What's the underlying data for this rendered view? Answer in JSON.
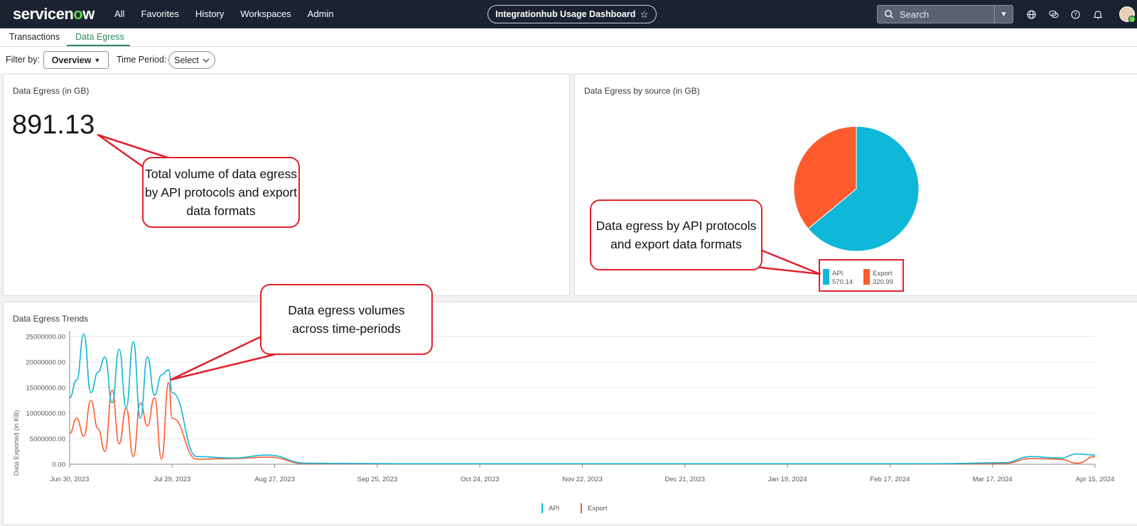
{
  "topbar": {
    "logo_text": "servicenow",
    "nav": [
      "All",
      "Favorites",
      "History",
      "Workspaces",
      "Admin"
    ],
    "title": "Integrationhub Usage Dashboard",
    "search_placeholder": "Search",
    "icons": [
      "globe-icon",
      "chat-icon",
      "help-icon",
      "bell-icon"
    ]
  },
  "tabs": [
    "Transactions",
    "Data Egress"
  ],
  "active_tab": "Data Egress",
  "filters": {
    "filter_by_label": "Filter by:",
    "filter_by_value": "Overview",
    "time_period_label": "Time Period:",
    "time_period_value": "Select"
  },
  "egress_card": {
    "title": "Data Egress (in GB)",
    "value": "891.13"
  },
  "source_card": {
    "title": "Data Egress by source (in GB)",
    "legend": [
      {
        "name": "API",
        "value": "570.14",
        "color": "#0fb7d8"
      },
      {
        "name": "Export",
        "value": "320.99",
        "color": "#ff5b2e"
      }
    ]
  },
  "trend_card": {
    "title": "Data Egress Trends",
    "ylabel": "Data Exported (in KB)",
    "legend": [
      "API",
      "Export"
    ]
  },
  "callouts": {
    "total": "Total volume of data egress by API protocols and export data formats",
    "pie": "Data egress by API protocols and export data formats",
    "trend": "Data egress volumes across time-periods"
  },
  "chart_data": [
    {
      "type": "pie",
      "title": "Data Egress by source (in GB)",
      "categories": [
        "API",
        "Export"
      ],
      "values": [
        570.14,
        320.99
      ],
      "colors": [
        "#0fb7d8",
        "#ff5b2e"
      ]
    },
    {
      "type": "line",
      "title": "Data Egress Trends",
      "ylabel": "Data Exported (in KB)",
      "ylim": [
        0,
        25000000
      ],
      "yticks": [
        "0.00",
        "5000000.00",
        "10000000.00",
        "15000000.00",
        "20000000.00",
        "25000000.00"
      ],
      "xticks": [
        "Jun 30, 2023",
        "Jul 29, 2023",
        "Aug 27, 2023",
        "Sep 25, 2023",
        "Oct 24, 2023",
        "Nov 22, 2023",
        "Dec 21, 2023",
        "Jan 19, 2024",
        "Feb 17, 2024",
        "Mar 17, 2024",
        "Apr 15, 2024"
      ],
      "grid": true,
      "legend_position": "bottom",
      "series": [
        {
          "name": "API",
          "color": "#0fb7d8",
          "x": [
            "2023-06-30",
            "2023-07-02",
            "2023-07-04",
            "2023-07-06",
            "2023-07-08",
            "2023-07-10",
            "2023-07-12",
            "2023-07-14",
            "2023-07-16",
            "2023-07-18",
            "2023-07-20",
            "2023-07-22",
            "2023-07-24",
            "2023-07-26",
            "2023-07-28",
            "2023-07-29",
            "2023-08-05",
            "2023-08-15",
            "2023-08-25",
            "2023-09-05",
            "2023-10-01",
            "2024-03-01",
            "2024-03-20",
            "2024-03-28",
            "2024-04-05",
            "2024-04-10",
            "2024-04-15"
          ],
          "values": [
            13000000,
            16500000,
            25500000,
            14000000,
            18000000,
            21000000,
            12000000,
            22500000,
            11000000,
            24000000,
            9000000,
            21000000,
            13500000,
            17500000,
            18500000,
            14000000,
            1500000,
            1200000,
            1800000,
            200000,
            100000,
            100000,
            300000,
            1500000,
            1200000,
            2000000,
            1800000
          ]
        },
        {
          "name": "Export",
          "color": "#ff5b2e",
          "x": [
            "2023-06-30",
            "2023-07-02",
            "2023-07-04",
            "2023-07-06",
            "2023-07-08",
            "2023-07-10",
            "2023-07-12",
            "2023-07-14",
            "2023-07-16",
            "2023-07-18",
            "2023-07-20",
            "2023-07-22",
            "2023-07-24",
            "2023-07-26",
            "2023-07-28",
            "2023-07-29",
            "2023-08-05",
            "2023-08-15",
            "2023-08-25",
            "2023-09-05",
            "2023-10-01",
            "2024-03-01",
            "2024-03-20",
            "2024-03-28",
            "2024-04-05",
            "2024-04-10",
            "2024-04-15"
          ],
          "values": [
            6000000,
            9000000,
            5500000,
            12500000,
            7000000,
            2500000,
            14500000,
            4000000,
            11000000,
            1500000,
            12000000,
            7500000,
            13000000,
            1000000,
            16000000,
            9000000,
            1000000,
            1100000,
            1400000,
            100000,
            80000,
            50000,
            150000,
            1100000,
            1000000,
            200000,
            1500000
          ]
        }
      ]
    }
  ]
}
